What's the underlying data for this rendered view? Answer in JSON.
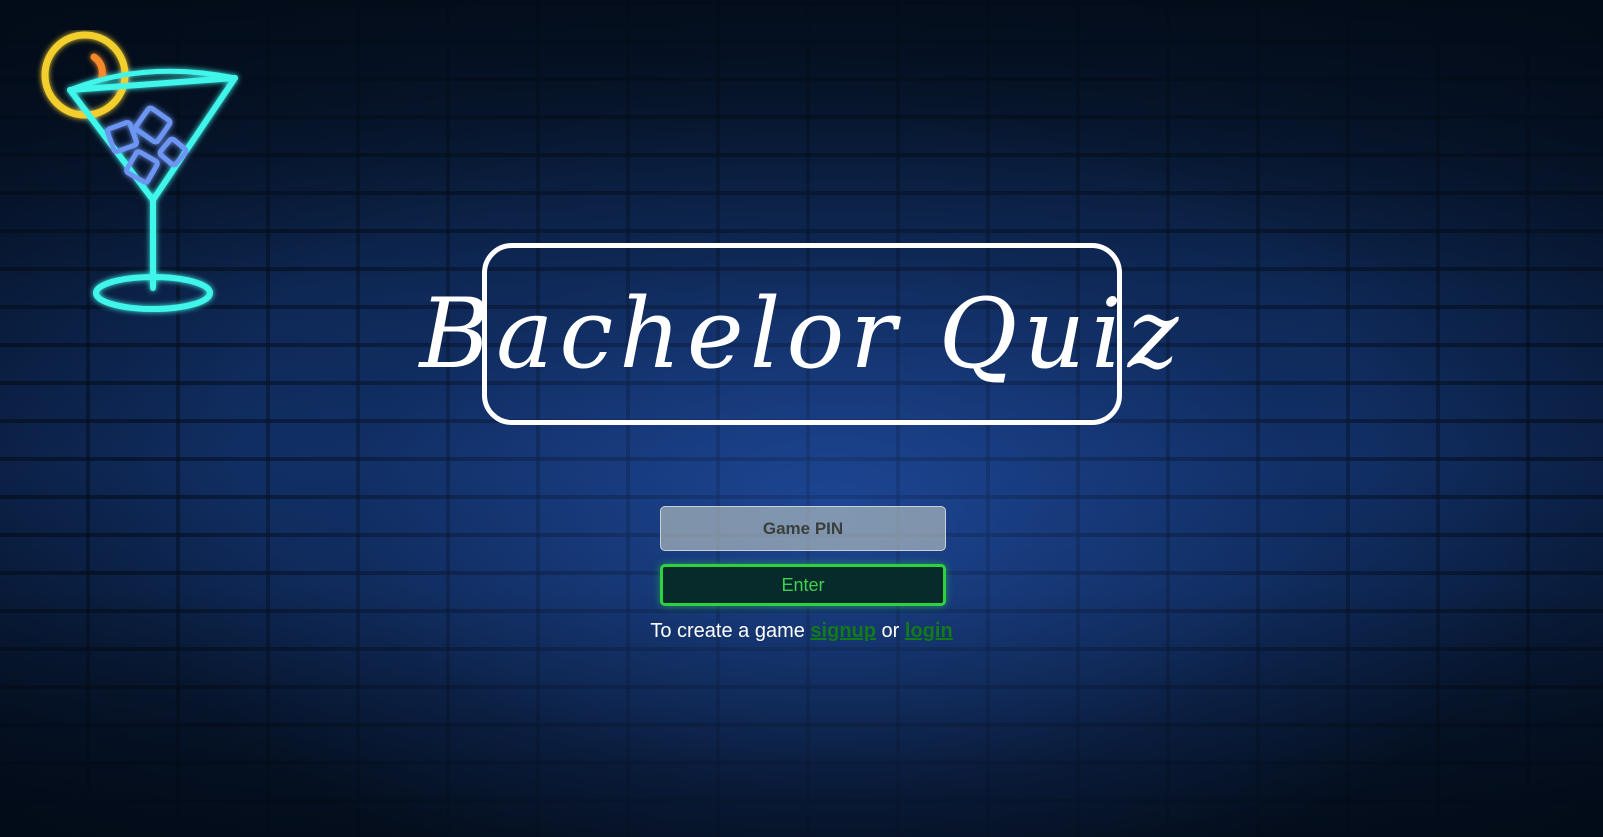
{
  "app": {
    "title": "Bachelor Quiz"
  },
  "decoration": {
    "icon": "martini-glass-icon",
    "colors": {
      "glass": "#3ff5ea",
      "ice": "#6d96f2",
      "lemon": "#f3cf2e",
      "lemon_inner": "#f48a2b"
    }
  },
  "join_form": {
    "pin_placeholder": "Game PIN",
    "pin_value": "",
    "enter_label": "Enter"
  },
  "create_prompt": {
    "text": "To create a game",
    "signup_label": "signup",
    "separator": "or",
    "login_label": "login"
  },
  "colors": {
    "accent_green": "#2ed13f",
    "link_green": "#127a17",
    "title_border": "#ffffff"
  }
}
